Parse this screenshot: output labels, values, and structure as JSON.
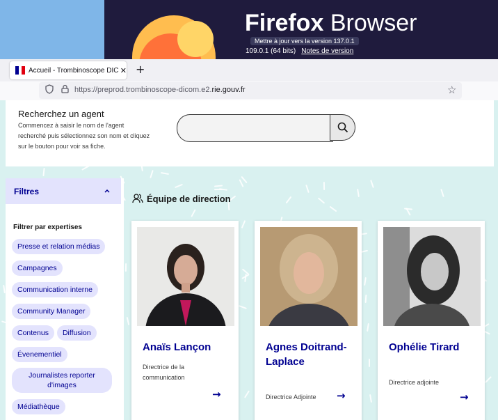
{
  "about": {
    "brand_bold": "Firefox",
    "brand_light": "Browser",
    "update_button": "Mettre à jour vers la version 137.0.1",
    "version": "109.0.1 (64 bits)",
    "release_notes": "Notes de version"
  },
  "browser": {
    "tab_title": "Accueil - Trombinoscope DICOM",
    "tab_close": "✕",
    "new_tab": "+",
    "url_prefix": "https://preprod.trombinoscope-dicom.e2.",
    "url_domain": "rie.gouv.fr"
  },
  "search": {
    "title": "Recherchez un agent",
    "help": "Commencez à saisir le nom de l'agent recherché puis sélectionnez son nom et cliquez sur le bouton pour voir sa fiche.",
    "value": ""
  },
  "filters": {
    "header": "Filtres",
    "section_title": "Filtrer par expertises",
    "tags": [
      "Presse et relation médias",
      "Campagnes",
      "Communication interne",
      "Community Manager",
      "Contenus",
      "Diffusion",
      "Évenementiel",
      "Journalistes reporter d'images",
      "Médiathèque"
    ]
  },
  "direction": {
    "title": "Équipe de direction",
    "cards": [
      {
        "name": "Anaïs Lançon",
        "role": "Directrice de la communication"
      },
      {
        "name": "Agnes Doitrand-Laplace",
        "role": "Directrice Adjointe"
      },
      {
        "name": "Ophélie Tirard",
        "role": "Directrice adjointe"
      }
    ]
  },
  "colors": {
    "accent": "#000091",
    "tag_bg": "#e3e3fd",
    "page_bg": "#d9f1f0"
  },
  "icons": {
    "search": "search-icon",
    "team": "team-icon",
    "arrow": "arrow-right-icon",
    "chevron": "chevron-up-icon"
  }
}
